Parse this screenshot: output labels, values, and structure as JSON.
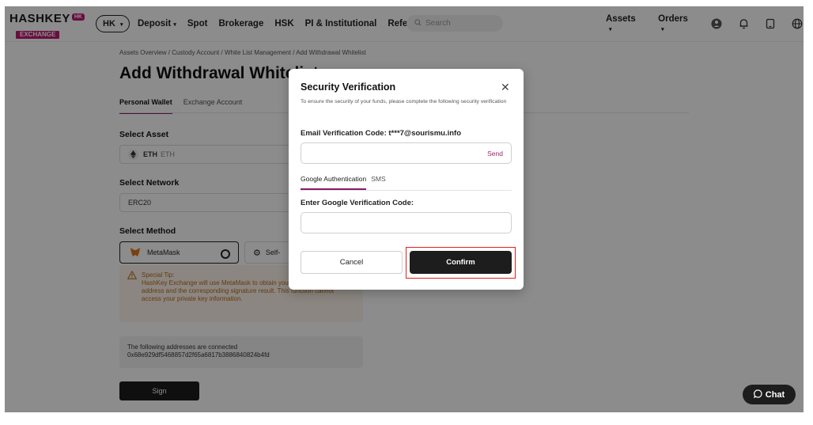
{
  "header": {
    "logo_text": "HASHKEY",
    "logo_badge": "HK",
    "logo_sub": "EXCHANGE",
    "region": "HK",
    "nav": [
      {
        "label": "Deposit",
        "has_dropdown": true
      },
      {
        "label": "Spot",
        "has_dropdown": false
      },
      {
        "label": "Brokerage",
        "has_dropdown": false
      },
      {
        "label": "HSK",
        "has_dropdown": false
      },
      {
        "label": "PI & Institutional",
        "has_dropdown": false
      },
      {
        "label": "Referral",
        "has_dropdown": false
      }
    ],
    "search_placeholder": "Search",
    "assets_label": "Assets",
    "orders_label": "Orders",
    "icons": [
      "user-icon",
      "bell-icon",
      "download-icon",
      "globe-icon"
    ]
  },
  "page": {
    "breadcrumb": "Assets Overview / Custody Account / White List Management / Add Withdrawal Whitelist",
    "title": "Add Withdrawal Whitelist",
    "tabs": {
      "personal": "Personal Wallet",
      "exchange": "Exchange Account"
    },
    "select_asset_label": "Select Asset",
    "asset_value": "ETH",
    "asset_sub": "ETH",
    "select_network_label": "Select Network",
    "network_value": "ERC20",
    "select_method_label": "Select Method",
    "method_metamask": "MetaMask",
    "method_self": "Self-",
    "tip_title": "Special Tip:",
    "tip_body": "HashKey Exchange will use MetaMask to obtain your personal wallet address and the corresponding signature result. This function cannot access your private key information.",
    "connected_title": "The following addresses are connected",
    "connected_address": "0x68e929df5468857d2f65a6817b3886840824b4fd",
    "sign_label": "Sign"
  },
  "modal": {
    "title": "Security Verification",
    "description": "To ensure the security of your funds, please complete the following security verification",
    "email_label": "Email Verification Code: t***7@sourismu.info",
    "send_label": "Send",
    "tabs": {
      "google": "Google Authentication",
      "sms": "SMS"
    },
    "google_label": "Enter Google Verification Code:",
    "cancel_label": "Cancel",
    "confirm_label": "Confirm"
  },
  "chat_label": "Chat",
  "colors": {
    "brand": "#c01a72",
    "accent": "#8a1c67",
    "highlight": "#e02020",
    "dark_button": "#1d1d1d"
  }
}
